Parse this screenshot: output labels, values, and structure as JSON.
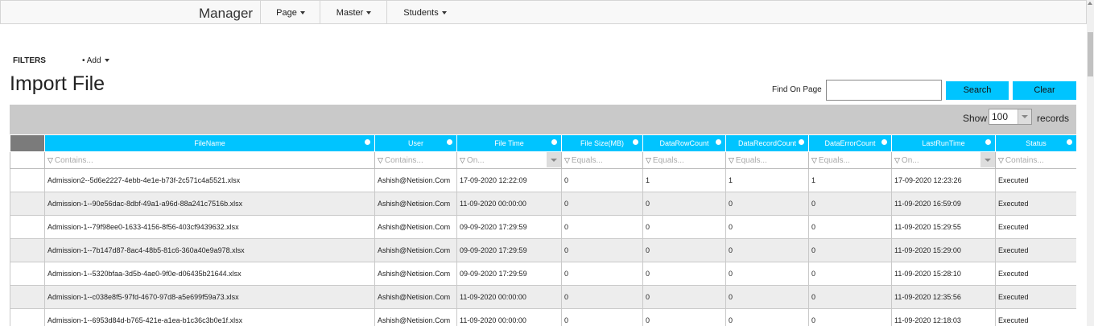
{
  "nav": {
    "brand": "Manager",
    "items": [
      {
        "label": "Page"
      },
      {
        "label": "Master"
      },
      {
        "label": "Students"
      }
    ]
  },
  "filters": {
    "label": "FILTERS",
    "add_label": "Add"
  },
  "page_title": "Import File",
  "find": {
    "label": "Find On Page",
    "value": "",
    "search_label": "Search",
    "clear_label": "Clear"
  },
  "grid": {
    "show_label": "Show",
    "page_size": "100",
    "records_label": "records",
    "columns": [
      "FileName",
      "User",
      "File Time",
      "File Size(MB)",
      "DataRowCount",
      "DataRecordCount",
      "DataErrorCount",
      "LastRunTime",
      "Status"
    ],
    "filter_placeholders": [
      "Contains...",
      "Contains...",
      "On...",
      "Equals...",
      "Equals...",
      "Equals...",
      "Equals...",
      "On...",
      "Contains..."
    ],
    "rows": [
      [
        "Admission2--5d6e2227-4ebb-4e1e-b73f-2c571c4a5521.xlsx",
        "Ashish@Netision.Com",
        "17-09-2020 12:22:09",
        "0",
        "1",
        "1",
        "1",
        "17-09-2020 12:23:26",
        "Executed"
      ],
      [
        "Admission-1--90e56dac-8dbf-49a1-a96d-88a241c7516b.xlsx",
        "Ashish@Netision.Com",
        "11-09-2020 00:00:00",
        "0",
        "0",
        "0",
        "0",
        "11-09-2020 16:59:09",
        "Executed"
      ],
      [
        "Admission-1--79f98ee0-1633-4156-8f56-403cf9439632.xlsx",
        "Ashish@Netision.Com",
        "09-09-2020 17:29:59",
        "0",
        "0",
        "0",
        "0",
        "11-09-2020 15:29:55",
        "Executed"
      ],
      [
        "Admission-1--7b147d87-8ac4-48b5-81c6-360a40e9a978.xlsx",
        "Ashish@Netision.Com",
        "09-09-2020 17:29:59",
        "0",
        "0",
        "0",
        "0",
        "11-09-2020 15:29:00",
        "Executed"
      ],
      [
        "Admission-1--5320bfaa-3d5b-4ae0-9f0e-d06435b21644.xlsx",
        "Ashish@Netision.Com",
        "09-09-2020 17:29:59",
        "0",
        "0",
        "0",
        "0",
        "11-09-2020 15:28:10",
        "Executed"
      ],
      [
        "Admission-1--c038e8f5-97fd-4670-97d8-a5e699f59a73.xlsx",
        "Ashish@Netision.Com",
        "11-09-2020 00:00:00",
        "0",
        "0",
        "0",
        "0",
        "11-09-2020 12:35:56",
        "Executed"
      ],
      [
        "Admission-1--6953d84d-b765-421e-a1ea-b1c36c3b0e1f.xlsx",
        "Ashish@Netision.Com",
        "11-09-2020 00:00:00",
        "0",
        "0",
        "0",
        "0",
        "11-09-2020 12:18:03",
        "Executed"
      ]
    ]
  },
  "colors": {
    "accent": "#00c4ff",
    "grid_bg": "#c9c9c9"
  }
}
